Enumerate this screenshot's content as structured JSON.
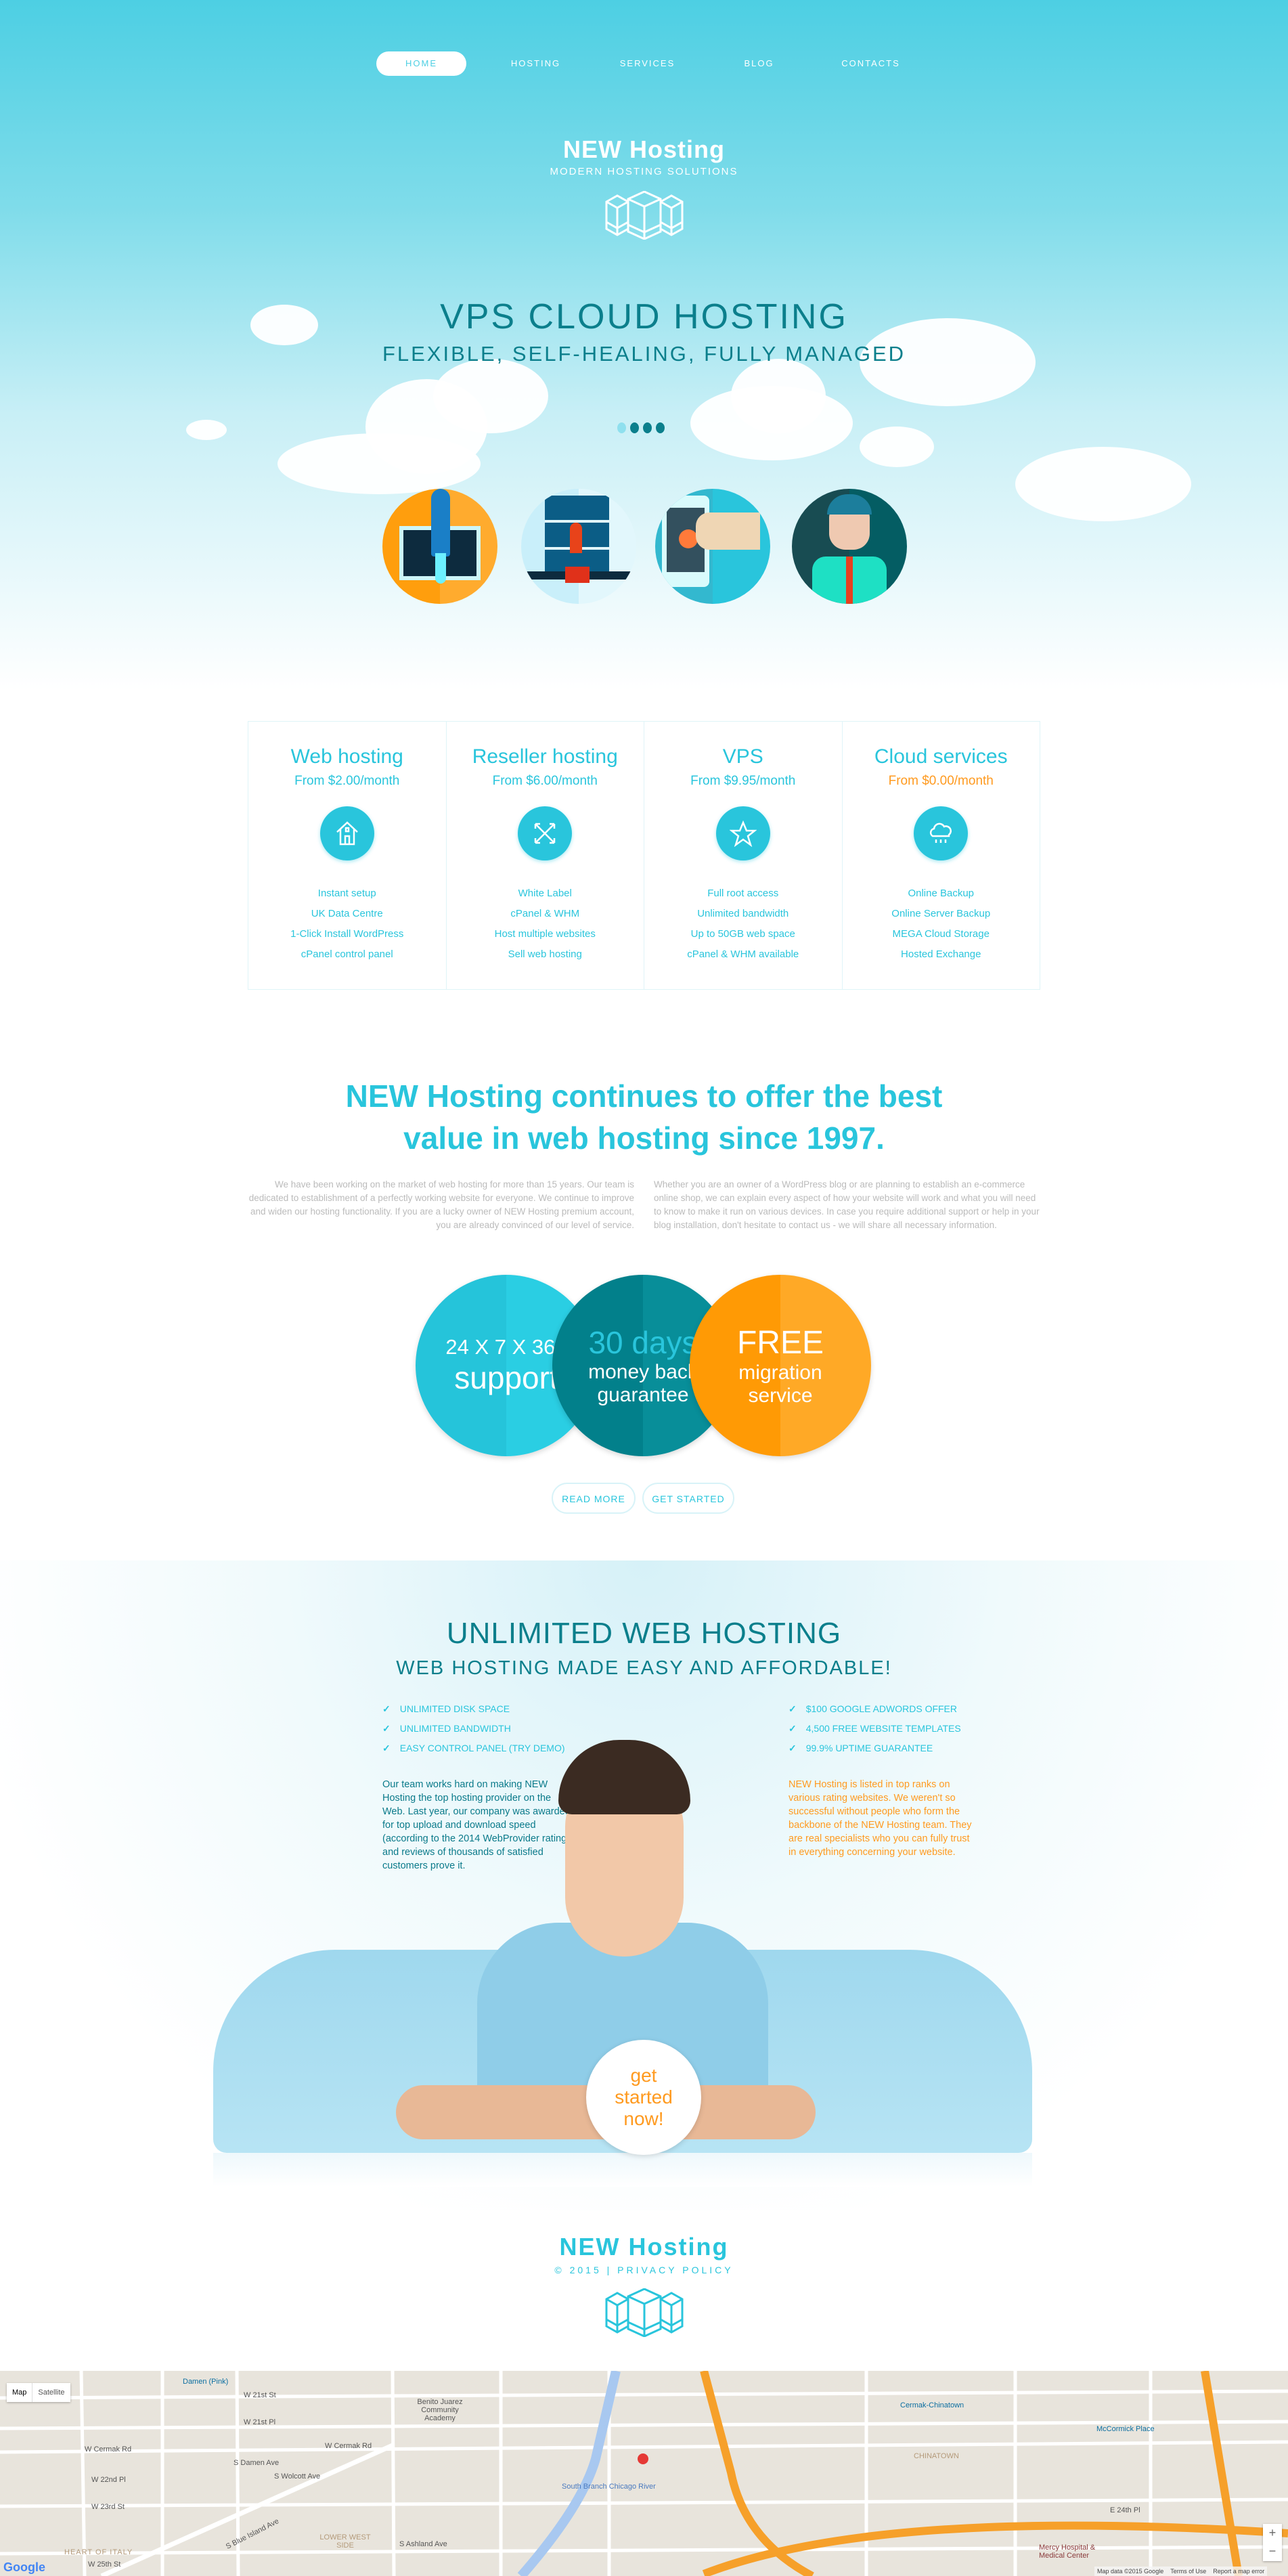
{
  "nav": {
    "items": [
      "HOME",
      "HOSTING",
      "SERVICES",
      "BLOG",
      "CONTACTS"
    ],
    "active": "HOME"
  },
  "header": {
    "brand": "NEW Hosting",
    "tagline": "MODERN HOSTING SOLUTIONS",
    "logo_icon": "server-cubes-icon"
  },
  "hero": {
    "title": "VPS CLOUD HOSTING",
    "subtitle": "FLEXIBLE, SELF-HEALING, FULLY MANAGED",
    "slides": 4,
    "active_slide": 1,
    "features": [
      "rocket-launch-icon",
      "server-lock-icon",
      "mobile-touch-icon",
      "support-agent-icon"
    ]
  },
  "pricing": [
    {
      "title": "Web hosting",
      "price": "From $2.00/month",
      "icon": "house-icon",
      "items": [
        "Instant setup",
        "UK Data Centre",
        "1-Click Install WordPress",
        "cPanel control panel"
      ]
    },
    {
      "title": "Reseller hosting",
      "price": "From $6.00/month",
      "icon": "arrows-expand-icon",
      "items": [
        "White Label",
        "cPanel & WHM",
        "Host multiple websites",
        "Sell web hosting"
      ]
    },
    {
      "title": "VPS",
      "price": "From $9.95/month",
      "icon": "star-icon",
      "items": [
        "Full root access",
        "Unlimited bandwidth",
        "Up to 50GB web space",
        "cPanel & WHM available"
      ]
    },
    {
      "title": "Cloud services",
      "price": "From $0.00/month",
      "icon": "cloud-rain-icon",
      "items": [
        "Online Backup",
        "Online Server Backup",
        "MEGA Cloud Storage",
        "Hosted Exchange"
      ]
    }
  ],
  "value": {
    "title_line1": "NEW Hosting continues to offer the best",
    "title_line2": "value in web hosting since 1997.",
    "para_left": "We have been working on the market of web hosting for more than 15 years. Our team is dedicated to establishment of a perfectly working website for everyone. We continue to improve and widen our hosting functionality. If you are a lucky owner of NEW Hosting premium account, you are already convinced of our level of service.",
    "para_right": "Whether you are an owner of a WordPress blog or are planning to establish an e-commerce online shop, we can explain every aspect of how your website will work and what you will need to know to make it run on various devices. In case you require additional support or help in your blog installation, don't hesitate to contact us - we will share all necessary information.",
    "circles": [
      {
        "line1": "24 X 7 X 365",
        "line2": "support",
        "color": "#29c5dc"
      },
      {
        "line1": "30 days",
        "line2": "money back",
        "line3": "guarantee",
        "color": "#07838f"
      },
      {
        "line1": "FREE",
        "line2": "migration",
        "line3": "service",
        "color": "#ff9e0d"
      }
    ],
    "read_more": "READ MORE",
    "get_started": "GET STARTED"
  },
  "unlimited": {
    "title": "UNLIMITED WEB HOSTING",
    "subtitle": "WEB HOSTING MADE EASY AND AFFORDABLE!",
    "left_list": [
      "UNLIMITED DISK SPACE",
      "UNLIMITED BANDWIDTH",
      "EASY CONTROL PANEL (TRY DEMO)"
    ],
    "right_list": [
      "$100 GOOGLE ADWORDS OFFER",
      "4,500 FREE WEBSITE TEMPLATES",
      "99.9% UPTIME GUARANTEE"
    ],
    "left_text": "Our team works hard on making NEW Hosting the top hosting provider on the Web. Last year, our company was awarded for top upload and download speed (according to the 2014 WebProvider rating) and reviews of thousands of satisfied customers prove it.",
    "right_text": "NEW Hosting is listed in top ranks on various rating websites. We weren't so successful without people who form the backbone of the NEW Hosting team. They are real specialists who you can fully trust in everything concerning your website.",
    "cta": [
      "get",
      "started",
      "now!"
    ]
  },
  "footer": {
    "brand": "NEW Hosting",
    "copyright": "© 2015 | ",
    "privacy": "PRIVACY POLICY"
  },
  "map": {
    "type_map": "Map",
    "type_satellite": "Satellite",
    "labels": [
      "Damen (Pink)",
      "W 21st St",
      "W 21st Pl",
      "W Cermak Rd",
      "W Cermak Rd",
      "S Damen Ave",
      "S Wolcott Ave",
      "S Blue Island Ave",
      "W 22nd Pl",
      "W 23rd St",
      "HEART OF ITALY",
      "LOWER WEST SIDE",
      "S Ashland Ave",
      "Benito Juarez Community Academy",
      "W 25th St",
      "Cermak-Chinatown",
      "CHINATOWN",
      "Mercy Hospital & Medical Center",
      "E 24th Pl",
      "McCormick Place",
      "South Branch Chicago River"
    ],
    "attribution": "Map data ©2015 Google",
    "terms": "Terms of Use",
    "report": "Report a map error",
    "zoom_in": "+",
    "zoom_out": "−"
  },
  "colors": {
    "accent": "#29c5dc",
    "dark_teal": "#0b7f8c",
    "orange": "#ff9a1f"
  }
}
